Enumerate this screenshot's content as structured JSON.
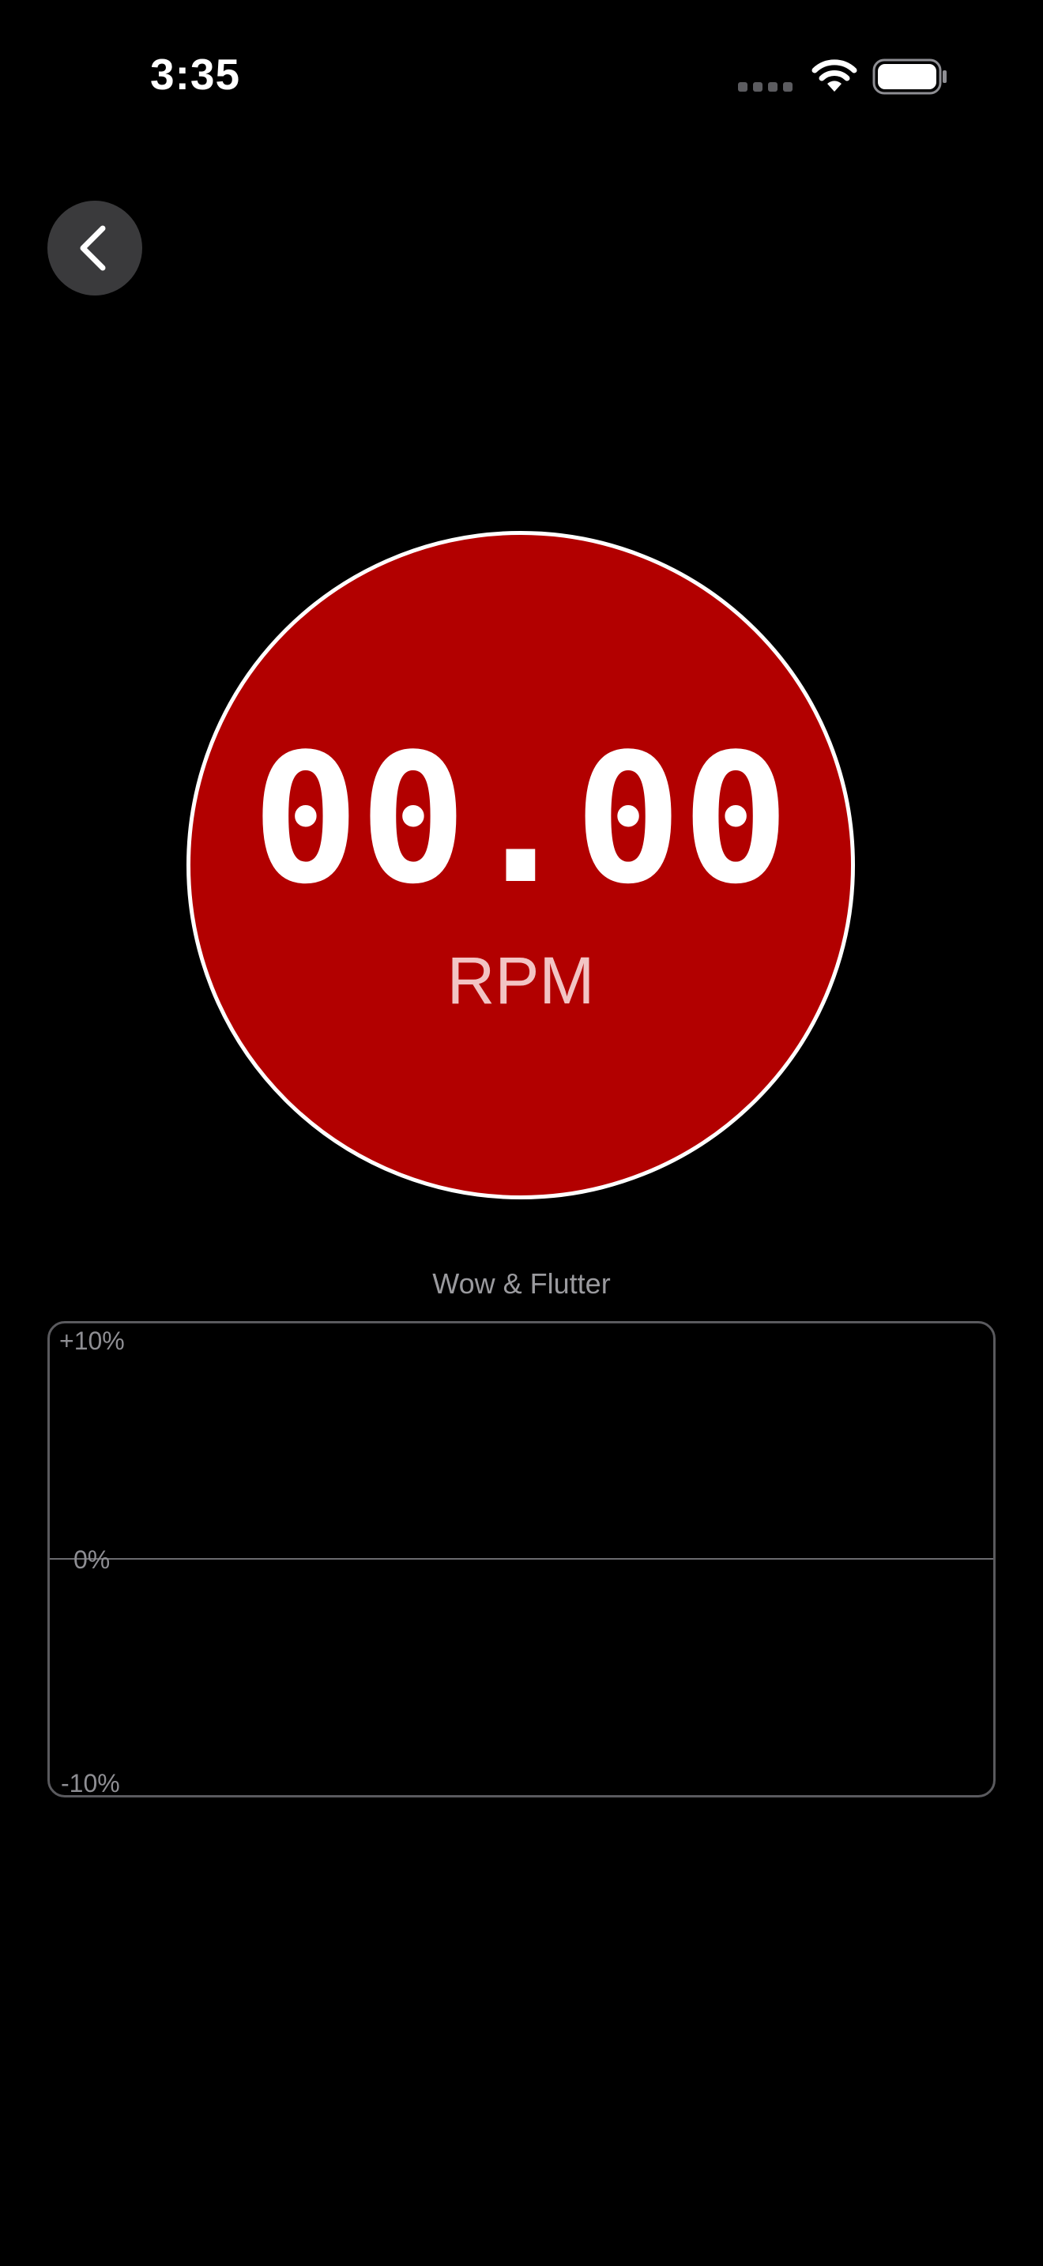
{
  "status_bar": {
    "time": "3:35",
    "icons": [
      "signal-dots-icon",
      "wifi-icon",
      "battery-icon"
    ]
  },
  "navigation": {
    "back_icon": "chevron-left-icon"
  },
  "speed": {
    "value": "00.00",
    "unit": "RPM",
    "dial_color": "#b20000"
  },
  "chart": {
    "title": "Wow & Flutter",
    "axis_labels": {
      "top": "+10%",
      "middle": "0%",
      "bottom": "-10%"
    }
  },
  "chart_data": {
    "type": "line",
    "title": "Wow & Flutter",
    "xlabel": "",
    "ylabel": "",
    "ylim": [
      -10,
      10
    ],
    "yticks": [
      "+10%",
      "0%",
      "-10%"
    ],
    "series": [],
    "grid": false
  }
}
